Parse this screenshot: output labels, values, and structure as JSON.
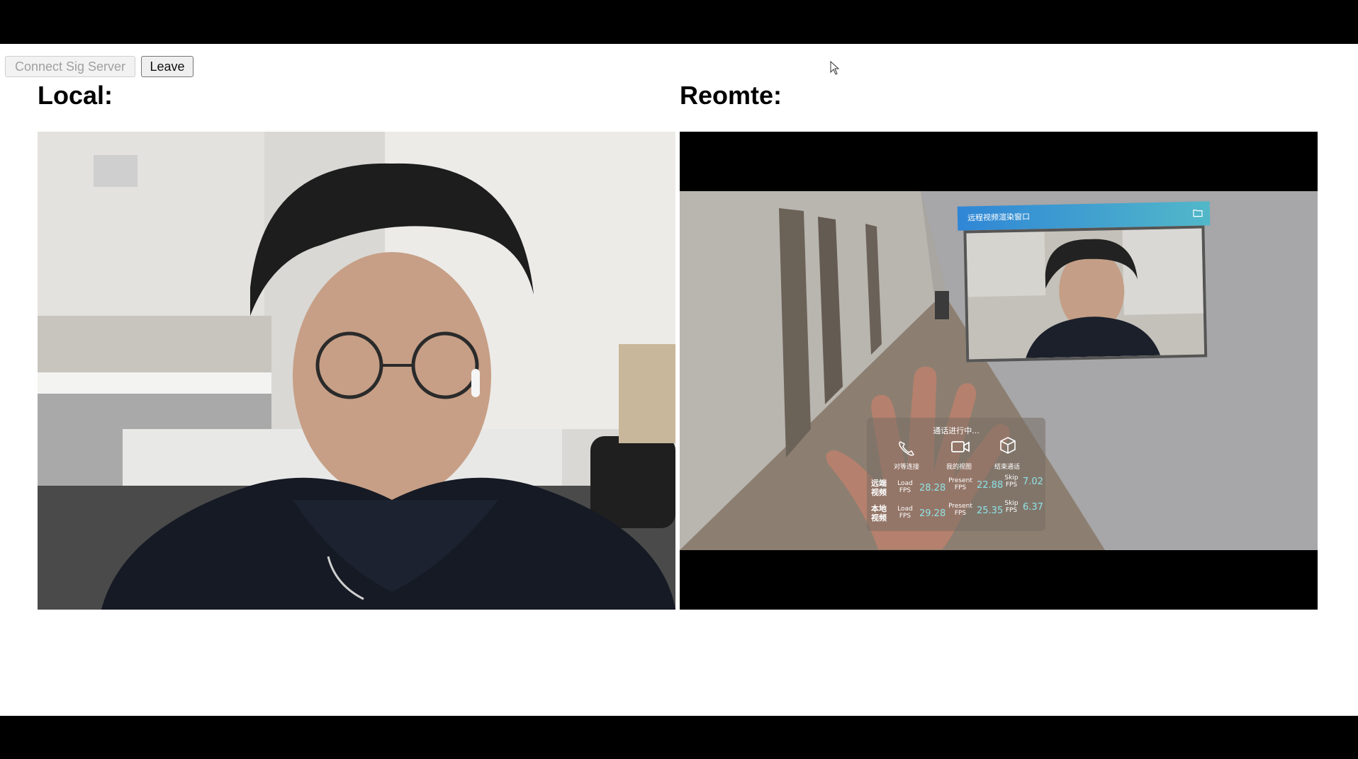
{
  "toolbar": {
    "connect_label": "Connect Sig Server",
    "leave_label": "Leave"
  },
  "sections": {
    "local_title": "Local:",
    "remote_title": "Reomte:"
  },
  "remote_overlay": {
    "window_title": "远程视频渲染窗口",
    "call_status": "通话进行中...",
    "actions": [
      {
        "label": "对等连接",
        "icon": "phone-icon"
      },
      {
        "label": "我的视图",
        "icon": "video-camera-icon"
      },
      {
        "label": "结束通话",
        "icon": "cube-icon"
      }
    ],
    "stats": [
      {
        "label": "远端视频",
        "load_key": "Load FPS",
        "load": "28.28",
        "present_key": "Present FPS",
        "present": "22.88",
        "skip_key": "Skip FPS",
        "skip": "7.02"
      },
      {
        "label": "本地视频",
        "load_key": "Load FPS",
        "load": "29.28",
        "present_key": "Present FPS",
        "present": "25.35",
        "skip_key": "Skip FPS",
        "skip": "6.37"
      }
    ]
  },
  "colors": {
    "bar": "#000000",
    "accent": "#2f86d6",
    "stat_value": "#8fe3e6"
  }
}
